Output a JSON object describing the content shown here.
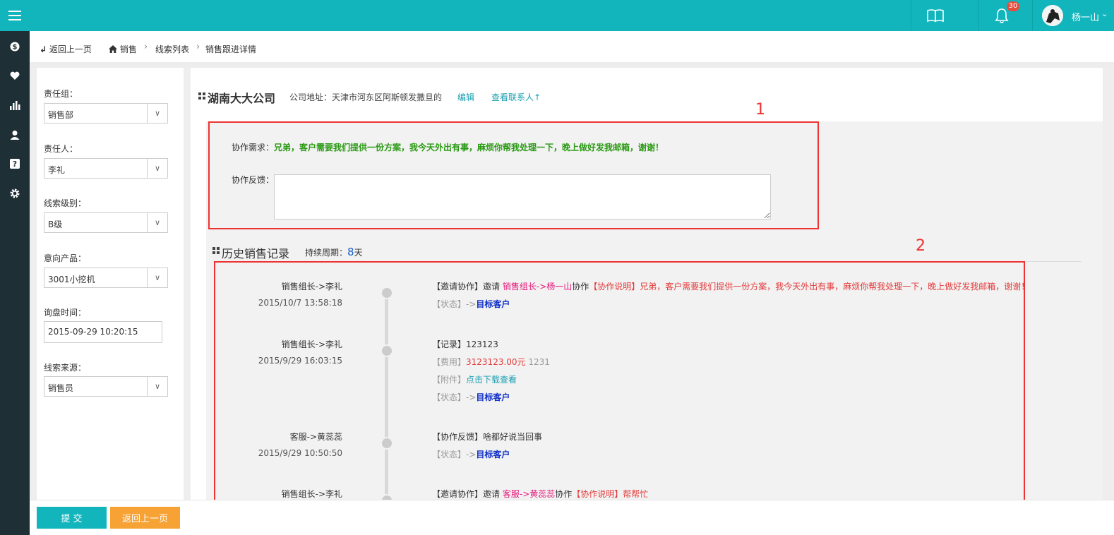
{
  "app": {
    "badge_count": "30",
    "user_name": "杨一山",
    "accent_color": "#13b5bd"
  },
  "rail_icons": [
    "menu-icon",
    "dollar-icon",
    "heart-icon",
    "bar-chart-icon",
    "user-icon",
    "help-icon",
    "gear-icon"
  ],
  "breadcrumb": {
    "back_label": "返回上一页",
    "home_label": "销售",
    "items": [
      "线索列表",
      "销售跟进详情"
    ]
  },
  "filters": {
    "group_label": "责任组：",
    "group_value": "销售部",
    "owner_label": "责任人：",
    "owner_value": "李礼",
    "level_label": "线索级别：",
    "level_value": "B级",
    "product_label": "意向产品：",
    "product_value": "3001小挖机",
    "time_label": "询盘时间：",
    "time_value": "2015-09-29 10:20:15",
    "source_label": "线索来源：",
    "source_value": "销售员"
  },
  "company": {
    "name": "湖南大大公司",
    "address": "公司地址：天津市河东区阿斯顿发撒旦的",
    "edit_label": "编辑",
    "contacts_label": "查看联系人↑"
  },
  "annotations": {
    "box1": "1",
    "box2": "2"
  },
  "collab": {
    "need_label": "协作需求：",
    "need_text": "兄弟，客户需要我们提供一份方案，我今天外出有事，麻烦你帮我处理一下，晚上做好发我邮箱，谢谢！",
    "feedback_label": "协作反馈：",
    "feedback_value": ""
  },
  "history": {
    "title": "历史销售记录",
    "period_label": "持续周期：",
    "period_value": "8",
    "period_unit": "天",
    "events": [
      {
        "who": "销售组长->李礼",
        "time": "2015/10/7 13:58:18",
        "tag": "【邀请协作】",
        "verb": "邀请",
        "target": "销售组长->杨一山",
        "suffix": "协作",
        "note_tag": "【协作说明】",
        "note": "兄弟，客户需要我们提供一份方案，我今天外出有事，麻烦你帮我处理一下，晚上做好发我邮箱，谢谢！",
        "state_tag": "【状态】",
        "arrow": "->",
        "state": "目标客户"
      },
      {
        "who": "销售组长->李礼",
        "time": "2015/9/29 16:03:15",
        "tag": "【记录】",
        "text": "123123",
        "fee_tag": "【费用】",
        "fee": "3123123.00元",
        "fee_note": "1231",
        "attach_tag": "【附件】",
        "attach": "点击下载查看",
        "state_tag": "【状态】",
        "arrow": "->",
        "state": "目标客户"
      },
      {
        "who": "客服->黄蕊蕊",
        "time": "2015/9/29 10:50:50",
        "tag": "【协作反馈】",
        "text": "啥都好说当回事",
        "state_tag": "【状态】",
        "arrow": "->",
        "state": "目标客户"
      },
      {
        "who": "销售组长->李礼",
        "tag": "【邀请协作】",
        "verb": "邀请",
        "target": "客服->黄蕊蕊",
        "suffix": "协作",
        "note_tag": "【协作说明】",
        "note": "帮帮忙"
      }
    ]
  },
  "bottom": {
    "submit_label": "提 交",
    "back_label": "返回上一页"
  }
}
